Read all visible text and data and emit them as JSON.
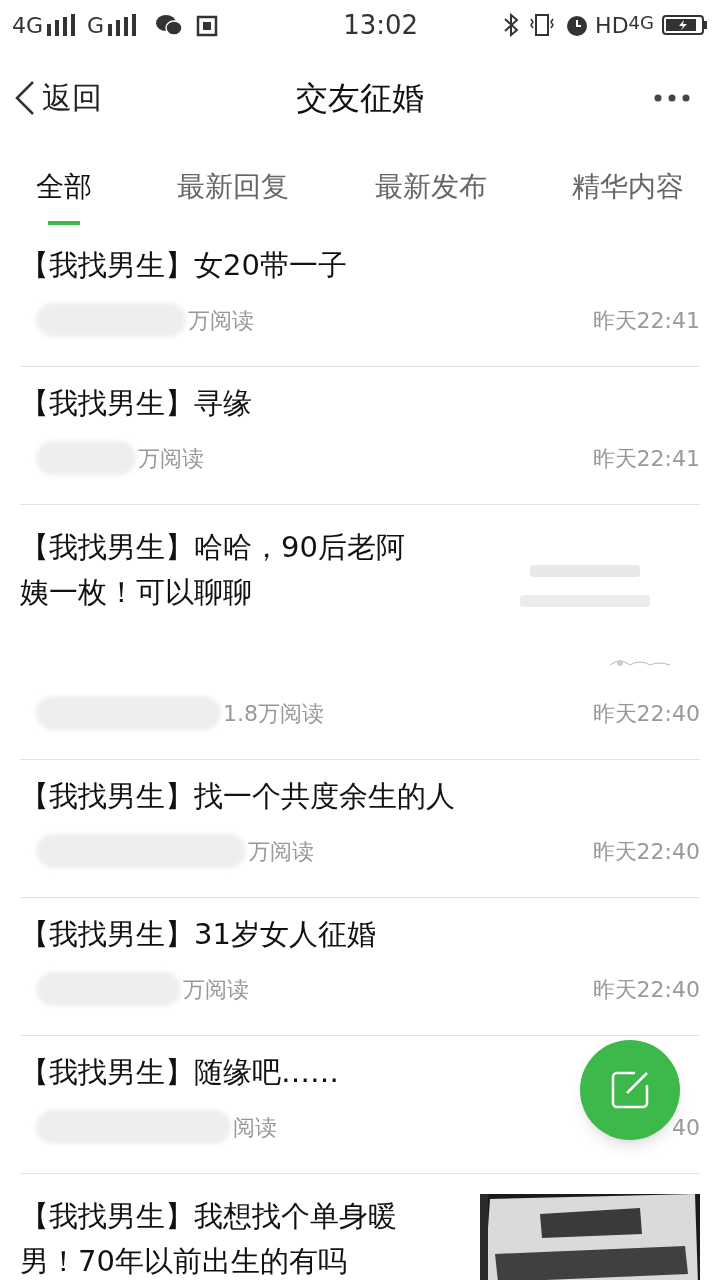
{
  "status_bar": {
    "network_1": "4G",
    "network_2": "G",
    "time": "13:02",
    "hd": "HD",
    "network_3": "4G"
  },
  "header": {
    "back": "返回",
    "title": "交友征婚"
  },
  "tabs": [
    {
      "label": "全部",
      "selected": true
    },
    {
      "label": "最新回复",
      "selected": false
    },
    {
      "label": "最新发布",
      "selected": false
    },
    {
      "label": "精华内容",
      "selected": false
    }
  ],
  "posts": [
    {
      "title": "【我找男生】女20带一子",
      "reads": "万阅读",
      "time": "昨天22:41"
    },
    {
      "title": "【我找男生】寻缘",
      "reads": "万阅读",
      "time": "昨天22:41"
    },
    {
      "title": "【我找男生】哈哈，90后老阿姨一枚！可以聊聊",
      "reads": "1.8万阅读",
      "time": "昨天22:40"
    },
    {
      "title": "【我找男生】找一个共度余生的人",
      "reads": "万阅读",
      "time": "昨天22:40"
    },
    {
      "title": "【我找男生】31岁女人征婚",
      "reads": "万阅读",
      "time": "昨天22:40"
    },
    {
      "title": "【我找男生】随缘吧……",
      "reads": "阅读",
      "time": "40"
    },
    {
      "title": "【我找男生】我想找个单身暖男！70年以前出生的有吗"
    }
  ]
}
